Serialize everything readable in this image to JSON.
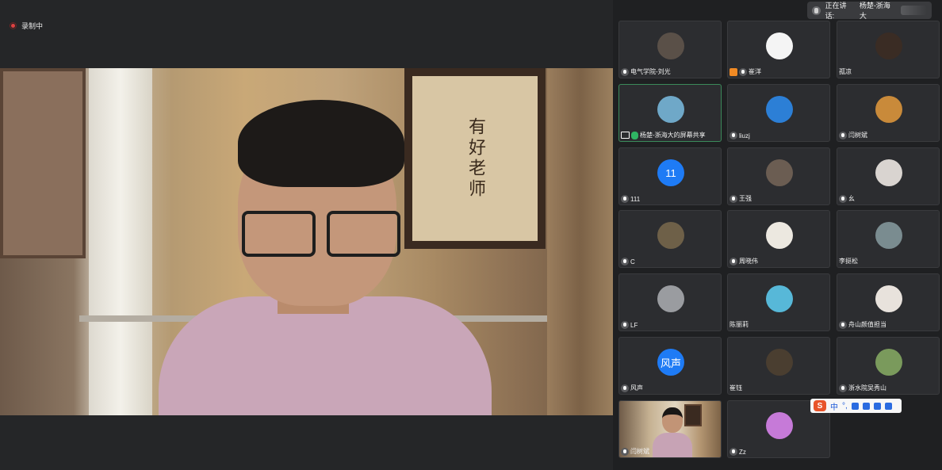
{
  "recording": {
    "label": "录制中"
  },
  "speaking": {
    "prefix": "正在讲话:",
    "name": "杨楚-浙海大"
  },
  "main_video": {
    "poster_text": "有好老师"
  },
  "participants": [
    {
      "name": "电气学院-刘光",
      "avatar": "#5a5048",
      "badge": "mic"
    },
    {
      "name": "崔洋",
      "avatar": "#f4f4f4",
      "badge": "host"
    },
    {
      "name": "孤凉",
      "avatar": "#3a2c24",
      "badge": "none"
    },
    {
      "name": "杨楚-浙海大的屏幕共享",
      "avatar": "#6fa8c8",
      "badge": "screen",
      "active": true
    },
    {
      "name": "liuzj",
      "avatar": "#2c7fd6",
      "badge": "mic"
    },
    {
      "name": "闫树斌",
      "avatar": "#c98a3a",
      "badge": "mic"
    },
    {
      "name": "111",
      "avatar_text": "11",
      "avatar": "#1e7bf5",
      "badge": "mic"
    },
    {
      "name": "王强",
      "avatar": "#6b5d52",
      "badge": "mic"
    },
    {
      "name": "幺",
      "avatar": "#d9d4d0",
      "badge": "mic"
    },
    {
      "name": "C",
      "avatar": "#6e6048",
      "badge": "mic"
    },
    {
      "name": "周晓伟",
      "avatar": "#ece8e0",
      "badge": "mic"
    },
    {
      "name": "李挺松",
      "avatar": "#7a8c90",
      "badge": "none"
    },
    {
      "name": "LF",
      "avatar": "#9a9ca0",
      "badge": "mic"
    },
    {
      "name": "陈丽莉",
      "avatar": "#57b8d8",
      "badge": "none"
    },
    {
      "name": "舟山颜值担当",
      "avatar": "#e8e2dc",
      "badge": "mic"
    },
    {
      "name": "风声",
      "avatar_text": "风声",
      "avatar": "#1e7bf5",
      "badge": "mic"
    },
    {
      "name": "崔钰",
      "avatar": "#4a3e30",
      "badge": "none"
    },
    {
      "name": "浙水院吴秀山",
      "avatar": "#7a9a5c",
      "badge": "mic"
    },
    {
      "name": "闫树斌",
      "self_video": true,
      "badge": "mic"
    },
    {
      "name": "Zz",
      "avatar": "#c67ad8",
      "badge": "mic"
    }
  ],
  "ime": {
    "logo": "S",
    "mode": "中",
    "punct": "°,"
  }
}
